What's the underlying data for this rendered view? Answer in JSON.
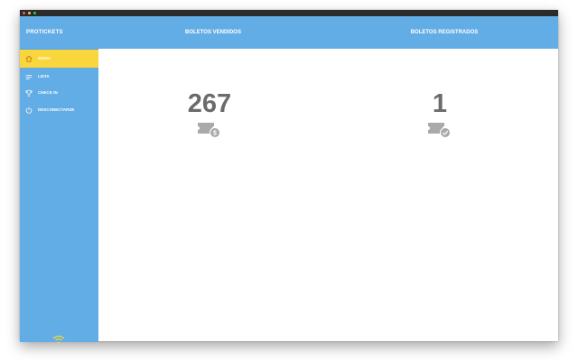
{
  "app": {
    "brand": "PROTICKETS"
  },
  "header": {
    "sold_title": "BOLETOS VENDIDOS",
    "registered_title": "BOLETOS REGISTRADOS"
  },
  "sidebar": {
    "items": [
      {
        "label": "INICIO",
        "icon": "home-icon",
        "active": true
      },
      {
        "label": "LISTA",
        "icon": "list-icon",
        "active": false
      },
      {
        "label": "CHECK IN",
        "icon": "trophy-icon",
        "active": false
      },
      {
        "label": "DESCONECTARSE",
        "icon": "power-icon",
        "active": false
      }
    ],
    "footer_icon": "wifi-icon"
  },
  "stats": {
    "sold": {
      "value": "267",
      "icon": "ticket-dollar-icon"
    },
    "registered": {
      "value": "1",
      "icon": "ticket-check-icon"
    }
  },
  "colors": {
    "primary": "#63ade6",
    "accent": "#f9d63b",
    "number": "#6b6b6b",
    "icon_gray": "#a9a9a9"
  }
}
